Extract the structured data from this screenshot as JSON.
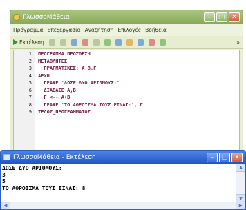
{
  "editor": {
    "title": "ΓλωσσοΜάθεια",
    "menu": [
      "Πρόγραμμα",
      "Επεξεργασία",
      "Αναζήτηση",
      "Επιλογές",
      "Βοήθεια"
    ],
    "toolbar": {
      "run_label": "Εκτέλεση",
      "more": "»"
    },
    "lines": [
      {
        "n": "1",
        "text": "ΠΡΟΓΡΑΜΜΑ ΠΡΟΣΘΕΣΗ"
      },
      {
        "n": "2",
        "text": "ΜΕΤΑΒΛΗΤΕΣ"
      },
      {
        "n": "3",
        "text": "  ΠΡΑΓΜΑΤΙΚΕΣ: Α,Β,Γ"
      },
      {
        "n": "4",
        "text": "ΑΡΧΗ"
      },
      {
        "n": "5",
        "text": "  ΓΡΑΨΕ 'ΔΩΣΕ ΔΥΟ ΑΡΙΘΜΟΥΣ:'"
      },
      {
        "n": "6",
        "text": "  ΔΙΑΒΑΣΕ Α,Β"
      },
      {
        "n": "7",
        "text": "  Γ <-- Α+Β"
      },
      {
        "n": "8",
        "text": "  ΓΡΑΨΕ 'ΤΟ ΑΘΡΟΙΣΜΑ ΤΟΥΣ ΕΙΝΑΙ:', Γ"
      },
      {
        "n": "9",
        "text": "ΤΕΛΟΣ_ΠΡΟΓΡΑΜΜΑΤΟΣ"
      }
    ]
  },
  "output": {
    "title": "ΓλωσσοΜάθεια - Εκτέλεση",
    "console": [
      "ΔΩΣΕ ΔΥΟ ΑΡΙΘΜΟΥΣ:",
      "3",
      "5",
      "ΤΟ ΑΘΡΟΙΣΜΑ ΤΟΥΣ ΕΙΝΑΙ: 8"
    ]
  },
  "icons": [
    "app-icon",
    "minimize-icon",
    "maximize-icon",
    "close-icon",
    "run-icon"
  ],
  "colors": {
    "editor_title": "#8fb064",
    "output_title": "#2a62d0",
    "keyword": "#7a1d47"
  }
}
